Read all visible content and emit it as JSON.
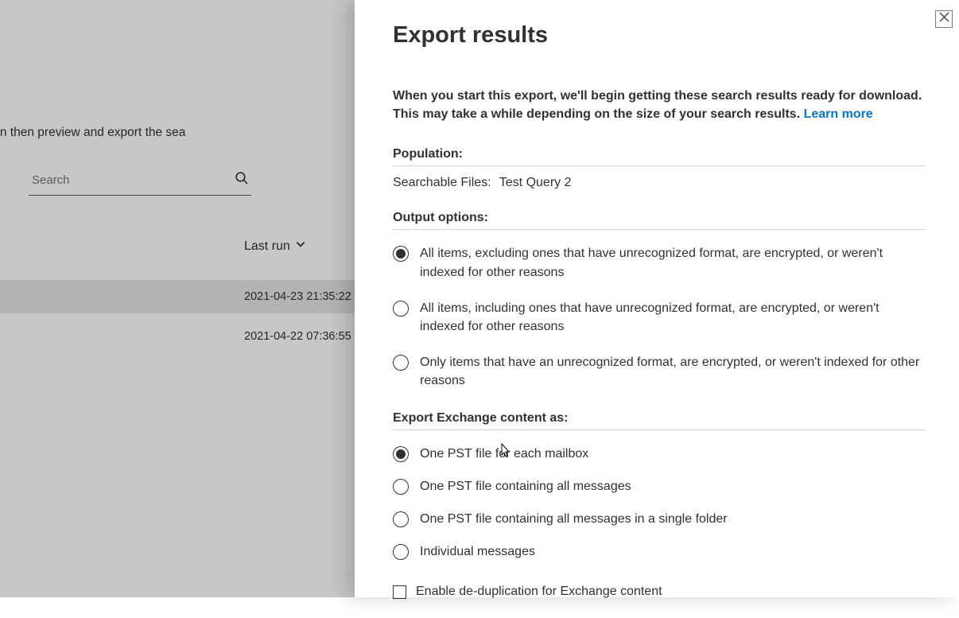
{
  "background": {
    "desc_fragment": "versations, and more. You can then preview and export the sea",
    "search_placeholder": "Search",
    "col_lastrun": "Last run",
    "rows": [
      {
        "last_run": "2021-04-23 21:35:22"
      },
      {
        "last_run": "2021-04-22 07:36:55"
      }
    ]
  },
  "modal": {
    "title": "Export results",
    "intro_bold": "When you start this export, we'll begin getting these search results ready for download. This may take a while depending on the size of your search results. ",
    "learn_more": "Learn more",
    "population_label": "Population:",
    "population_key": "Searchable Files:",
    "population_value": "Test Query 2",
    "output_label": "Output options:",
    "output_options": [
      "All items, excluding ones that have unrecognized format, are encrypted, or weren't indexed for other reasons",
      "All items, including ones that have unrecognized format, are encrypted, or weren't indexed for other reasons",
      "Only items that have an unrecognized format, are encrypted, or weren't indexed for other reasons"
    ],
    "output_selected": 0,
    "export_as_label": "Export Exchange content as:",
    "export_as_options": [
      "One PST file for each mailbox",
      "One PST file containing all messages",
      "One PST file containing all messages in a single folder",
      "Individual messages"
    ],
    "export_as_selected": 0,
    "dedup_label": "Enable de-duplication for Exchange content"
  }
}
